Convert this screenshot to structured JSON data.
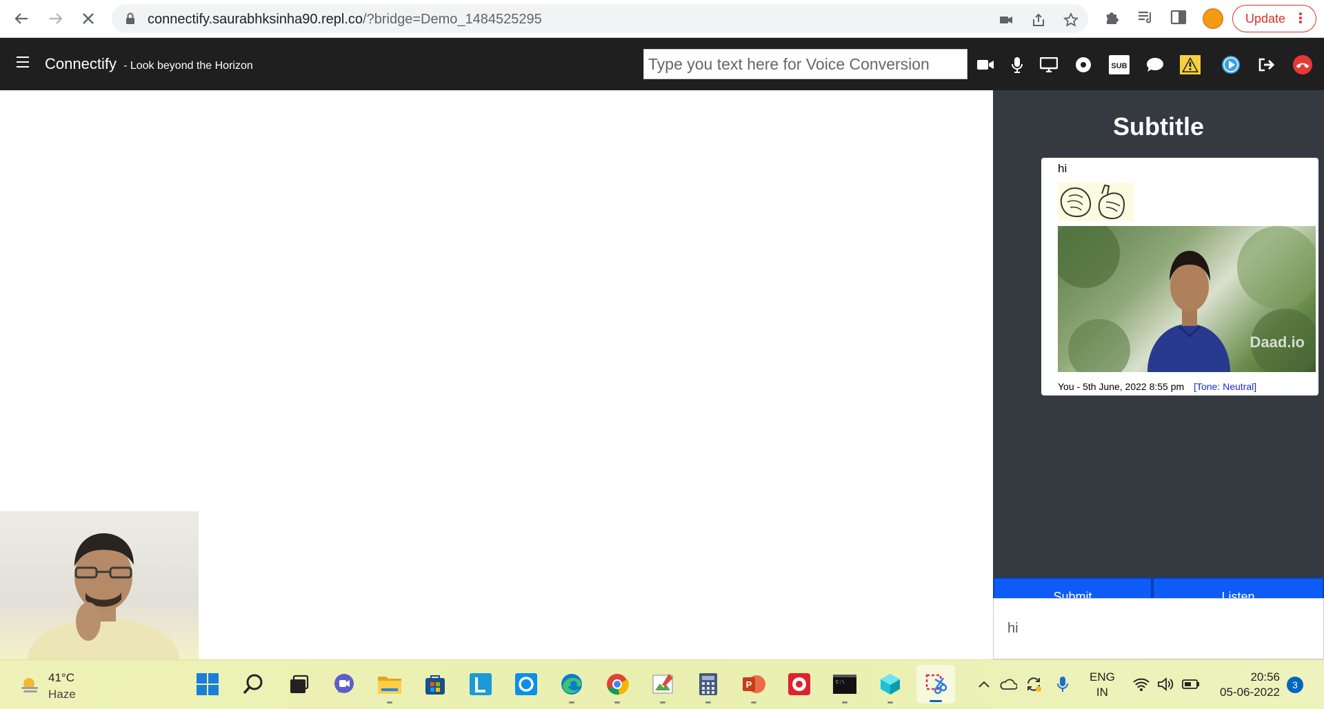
{
  "browser": {
    "url_host": "connectify.saurabhksinha90.repl.co",
    "url_query": "/?bridge=Demo_1484525295",
    "update_label": "Update"
  },
  "navbar": {
    "brand": "Connectify",
    "tagline": "- Look beyond the Horizon",
    "voice_placeholder": "Type you text here for Voice Conversion",
    "icons": [
      "video-camera-icon",
      "microphone-icon",
      "screen-share-icon",
      "record-icon",
      "subtitle-icon",
      "chat-icon",
      "warning-icon",
      "play-icon",
      "leave-icon",
      "hang-up-icon"
    ],
    "sub_label": "SUB"
  },
  "panel": {
    "title": "Subtitle",
    "message": {
      "text": "hi",
      "meta": "You - 5th June, 2022 8:55 pm",
      "tone": "[Tone: Neutral]",
      "watermark": "Daad.io"
    },
    "submit_label": "Submit",
    "listen_label": "Listen",
    "input_value": "hi"
  },
  "taskbar": {
    "weather_temp": "41°C",
    "weather_desc": "Haze",
    "lang_line1": "ENG",
    "lang_line2": "IN",
    "time": "20:56",
    "date": "05-06-2022",
    "notifications": "3",
    "apps": [
      "windows-start-icon",
      "search-icon",
      "task-view-icon",
      "teams-chat-icon",
      "file-explorer-icon",
      "microsoft-store-icon",
      "l-app-icon",
      "cortana-icon",
      "edge-icon",
      "chrome-icon",
      "paint-icon",
      "calculator-icon",
      "powerpoint-icon",
      "screen-recorder-icon",
      "terminal-icon",
      "3d-viewer-icon",
      "snipping-tool-icon"
    ]
  }
}
